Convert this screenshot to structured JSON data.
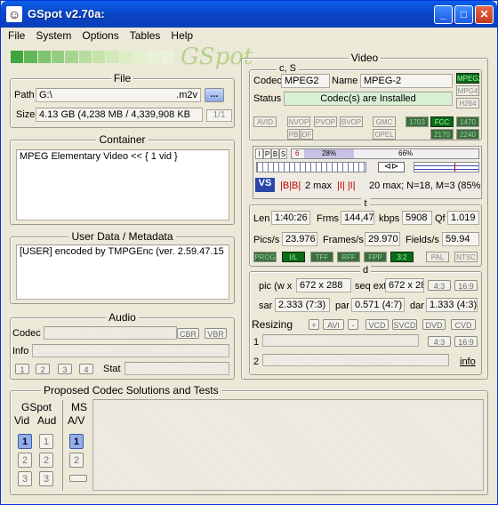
{
  "window": {
    "title": "GSpot v2.70a:",
    "minimize": "_",
    "maximize": "□",
    "close": "✕",
    "icon": "gspot-icon"
  },
  "menu": [
    "File",
    "System",
    "Options",
    "Tables",
    "Help"
  ],
  "logo": "GSpot",
  "colors": {
    "title_blue": "#0845C8",
    "led_on": "#0C6A19",
    "strip": [
      "#3FA53C",
      "#63B657",
      "#7FC36D",
      "#96CE81",
      "#A6D58F",
      "#B8DC9F",
      "#C6E3AD",
      "#D3E8BA",
      "#DCEDC6",
      "#E3EFCE",
      "#E9F1D6",
      "#ECF3DC"
    ]
  },
  "file": {
    "title": "File",
    "path_label": "Path",
    "path_value": "G:\\",
    "path_ext": ".m2v",
    "browse": "...",
    "size_label": "Size",
    "size_value": "4.13 GB (4,238 MB / 4,339,908 KB",
    "page": "1/1"
  },
  "container": {
    "title": "Container",
    "value": "MPEG Elementary Video << { 1 vid }"
  },
  "userdata": {
    "title": "User Data / Metadata",
    "value": "[USER]    encoded by TMPGEnc (ver. 2.59.47.15"
  },
  "audio": {
    "title": "Audio",
    "codec_label": "Codec",
    "info_label": "Info",
    "cbr": "CBR",
    "vbr": "VBR",
    "nums": [
      "1",
      "2",
      "3",
      "4"
    ],
    "stat_label": "Stat"
  },
  "video": {
    "title": "Video",
    "cs_label": "c, S",
    "codec_label": "Codec",
    "codec_value": "MPEG2",
    "name_label": "Name",
    "name_value": "MPEG-2",
    "status_label": "Status",
    "status_value": "Codec(s) are Installed",
    "leds_right": [
      "MPEG2",
      "MPG4",
      "H264"
    ],
    "flags_row1": [
      "AVID",
      "NVOP",
      "PVOP",
      "BVOP",
      "GMC",
      "1703",
      "FCC",
      "1470"
    ],
    "flags_row2": [
      "PB",
      "DF",
      "OPEL",
      "2170",
      "2240"
    ],
    "ipbs": [
      "I",
      "P",
      "B",
      "S"
    ],
    "pct_left": "28%",
    "pct_right": "66%",
    "bframes": "2 max",
    "gop": "20 max; N=18, M=3 (85%",
    "t_label": "t",
    "len_label": "Len",
    "len_value": "1:40:26",
    "frms_label": "Frms",
    "frms_value": "144,47",
    "kbps_label": "kbps",
    "kbps_value": "5908",
    "qf_label": "Qf",
    "qf_value": "1.019",
    "pics_label": "Pics/s",
    "pics_value": "23.976",
    "frames_label": "Frames/s",
    "frames_value": "29.970",
    "fields_label": "Fields/s",
    "fields_value": "59.94",
    "leds_t": [
      "PROG",
      "I/L",
      "TFF",
      "RFF",
      "FPP",
      "3:2",
      "PAL",
      "NTSC"
    ],
    "d_label": "d",
    "pic_label": "pic (w x",
    "pic_value": "672 x 288",
    "seq_label": "seq ext",
    "seq_value": "672 x 28",
    "ar1": "4:3",
    "ar2": "16:9",
    "sar_label": "sar",
    "sar_value": "2.333 (7:3)",
    "par_label": "par",
    "par_value": "0.571 (4:7)",
    "dar_label": "dar",
    "dar_value": "1.333 (4:3)",
    "resizing_label": "Resizing",
    "resize_btns": [
      "+",
      "AVI",
      "-",
      "VCD",
      "SVCD",
      "DVD",
      "CVD"
    ],
    "row1": "1",
    "row2": "2",
    "ar3": "4:3",
    "ar4": "16:9",
    "info_link": "info"
  },
  "proposed": {
    "title": "Proposed Codec Solutions and Tests",
    "gspot": "GSpot",
    "vid": "Vid",
    "aud": "Aud",
    "ms": "MS",
    "av": "A/V",
    "nums": [
      "1",
      "2",
      "3"
    ]
  }
}
